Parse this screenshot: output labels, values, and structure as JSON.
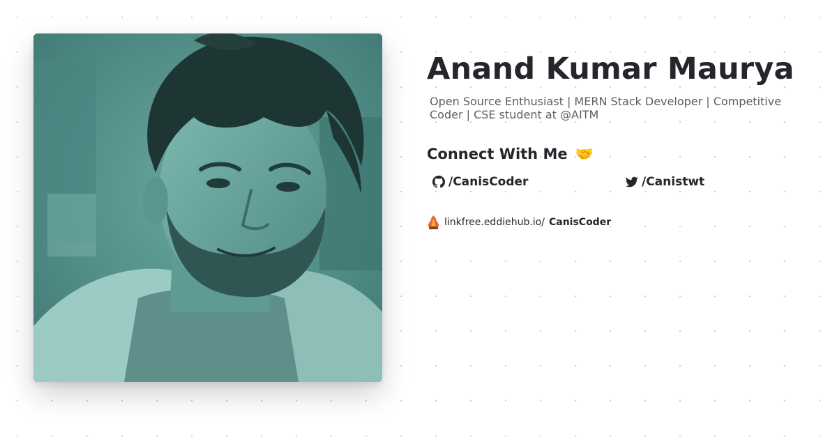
{
  "profile": {
    "name": "Anand Kumar Maurya",
    "bio": "Open Source Enthusiast | MERN Stack Developer | Competitive Coder | CSE student at @AITM",
    "photo_icon": "profile-photo",
    "photo_tint": "#5b9a95"
  },
  "connect": {
    "heading": "Connect With Me",
    "emoji": "🤝",
    "links": [
      {
        "icon": "github-icon",
        "label": "/CanisCoder"
      },
      {
        "icon": "twitter-icon",
        "label": "/Canistwt"
      }
    ]
  },
  "linkfree": {
    "icon": "linkfree-logo",
    "prefix": "linkfree.eddiehub.io/",
    "handle": "CanisCoder"
  },
  "colors": {
    "text": "#24262b",
    "muted": "#5c5f66",
    "background": "#ffffff",
    "dots": "#c9cbd0"
  }
}
